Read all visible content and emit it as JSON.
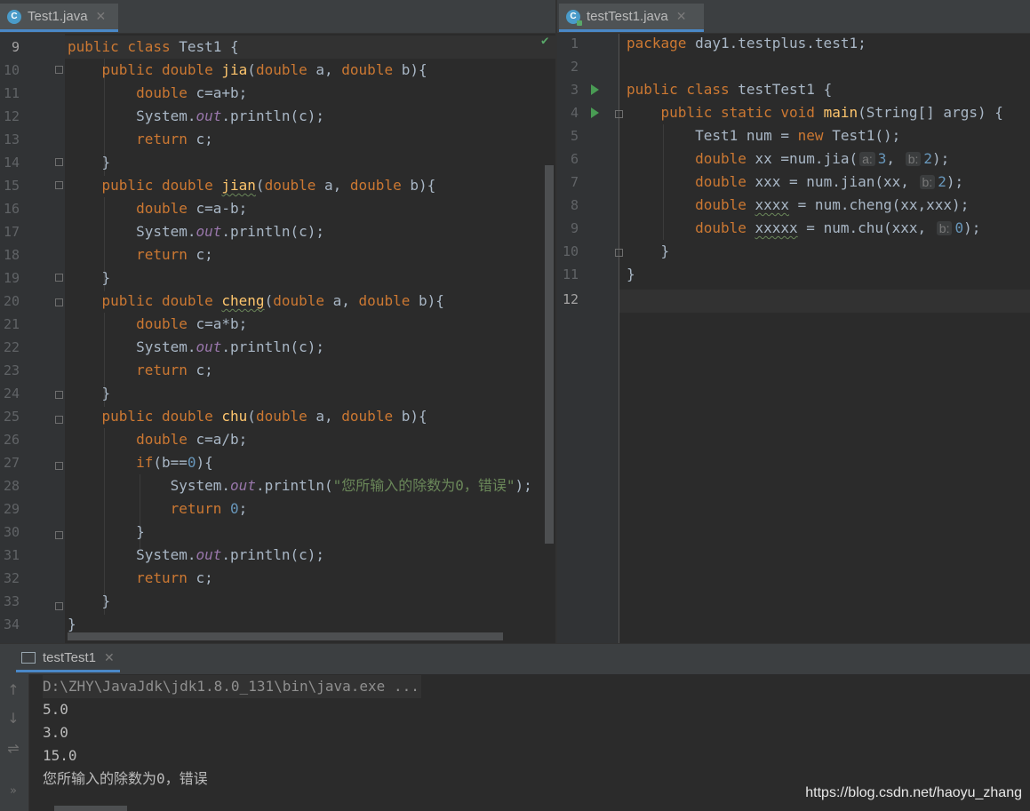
{
  "left_tab": {
    "icon": "C",
    "label": "Test1.java",
    "close": "✕"
  },
  "right_tab": {
    "icon": "C",
    "label": "testTest1.java",
    "close": "✕"
  },
  "left_editor": {
    "line_numbers": [
      "9",
      "10",
      "11",
      "12",
      "13",
      "14",
      "15",
      "16",
      "17",
      "18",
      "19",
      "20",
      "21",
      "22",
      "23",
      "24",
      "25",
      "26",
      "27",
      "28",
      "29",
      "30",
      "31",
      "32",
      "33",
      "34"
    ],
    "lines": [
      "public class Test1 {",
      "    public double jia(double a, double b){",
      "        double c=a+b;",
      "        System.out.println(c);",
      "        return c;",
      "    }",
      "    public double jian(double a, double b){",
      "        double c=a-b;",
      "        System.out.println(c);",
      "        return c;",
      "    }",
      "    public double cheng(double a, double b){",
      "        double c=a*b;",
      "        System.out.println(c);",
      "        return c;",
      "    }",
      "    public double chu(double a, double b){",
      "        double c=a/b;",
      "        if(b==0){",
      "            System.out.println(\"您所输入的除数为0，错误\");",
      "            return 0;",
      "        }",
      "        System.out.println(c);",
      "        return c;",
      "    }",
      "}"
    ]
  },
  "right_editor": {
    "line_numbers": [
      "1",
      "2",
      "3",
      "4",
      "5",
      "6",
      "7",
      "8",
      "9",
      "10",
      "11",
      "12"
    ],
    "lines": [
      "package day1.testplus.test1;",
      "",
      "public class testTest1 {",
      "    public static void main(String[] args) {",
      "        Test1 num = new Test1();",
      "        double xx =num.jia( a: 3, b: 2);",
      "        double xxx = num.jian(xx, b: 2);",
      "        double xxxx = num.cheng(xx,xxx);",
      "        double xxxxx = num.chu(xxx, b: 0);",
      "    }",
      "}",
      ""
    ]
  },
  "console": {
    "tab_label": "testTest1",
    "close": "✕",
    "output": [
      "D:\\ZHY\\JavaJdk\\jdk1.8.0_131\\bin\\java.exe ...",
      "5.0",
      "3.0",
      "15.0",
      "您所输入的除数为0，错误"
    ]
  },
  "watermark": "https://blog.csdn.net/haoyu_zhang",
  "tools": {
    "up": "↑",
    "down": "↓",
    "wrap": "⇌",
    "more": "»"
  },
  "colors": {
    "keyword": "#cc7832",
    "function": "#ffc66d",
    "static_field": "#9876aa",
    "number": "#6897bb",
    "string": "#6a8759",
    "text": "#a9b7c6",
    "background": "#2b2b2b"
  }
}
